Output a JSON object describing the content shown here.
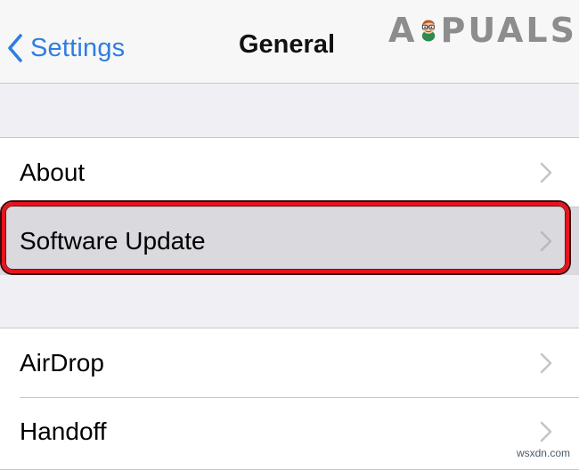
{
  "navbar": {
    "back_label": "Settings",
    "title": "General",
    "back_icon": "chevron-left-icon"
  },
  "logo": {
    "text_left": "A",
    "text_right": "PUALS"
  },
  "groups": [
    {
      "rows": [
        {
          "label": "About",
          "icon": "chevron-right-icon"
        },
        {
          "label": "Software Update",
          "icon": "chevron-right-icon",
          "highlighted": true
        }
      ]
    },
    {
      "rows": [
        {
          "label": "AirDrop",
          "icon": "chevron-right-icon"
        },
        {
          "label": "Handoff",
          "icon": "chevron-right-icon"
        }
      ]
    }
  ],
  "colors": {
    "accent": "#2f7de1",
    "highlight_border": "#e8131c",
    "background": "#efeff4"
  },
  "watermark": "wsxdn.com"
}
